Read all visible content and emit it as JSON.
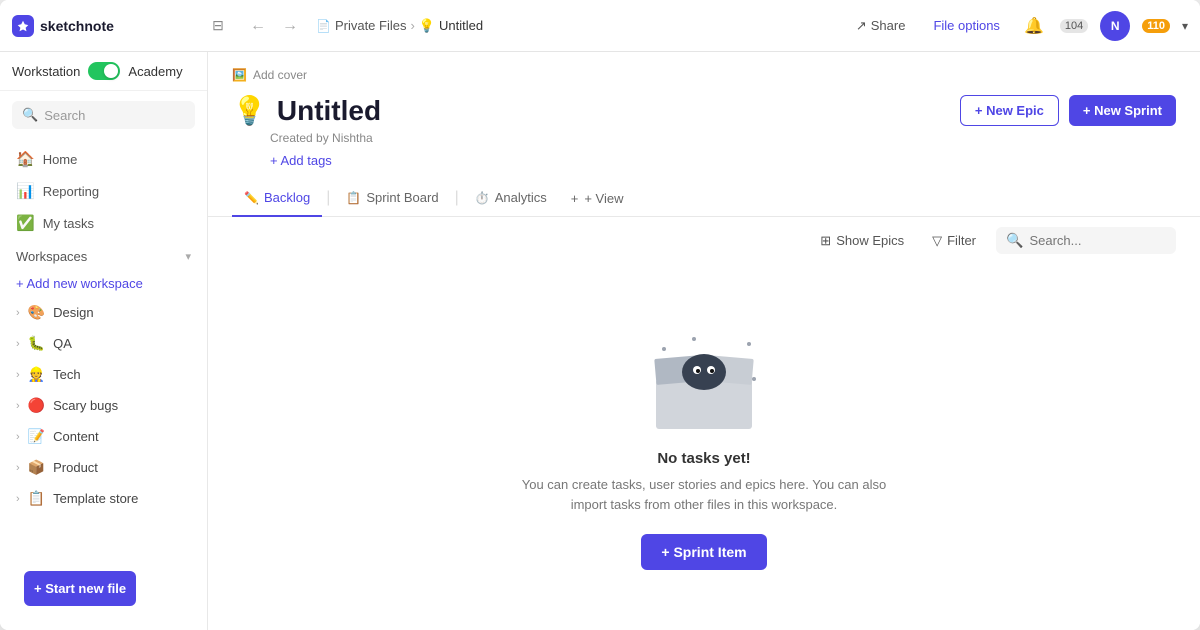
{
  "app": {
    "name": "sketchnote",
    "logo_emoji": "⚡"
  },
  "titlebar": {
    "workspace": "Workstation",
    "workspace_mode": "Academy",
    "breadcrumb": {
      "section": "Private Files",
      "current": "Untitled"
    },
    "share_label": "Share",
    "file_options_label": "File options",
    "notif_count": "104",
    "user_count": "110"
  },
  "sidebar": {
    "search_placeholder": "Search",
    "nav_items": [
      {
        "label": "Home",
        "icon": "🏠"
      },
      {
        "label": "Reporting",
        "icon": "📊"
      },
      {
        "label": "My tasks",
        "icon": "✅"
      }
    ],
    "workspaces_label": "Workspaces",
    "add_workspace_label": "+ Add new workspace",
    "workspace_items": [
      {
        "label": "Design",
        "emoji": "🎨"
      },
      {
        "label": "QA",
        "emoji": "🐛"
      },
      {
        "label": "Tech",
        "emoji": "👷"
      },
      {
        "label": "Scary bugs",
        "emoji": "🔴"
      },
      {
        "label": "Content",
        "emoji": "📝"
      },
      {
        "label": "Product",
        "emoji": "📦"
      },
      {
        "label": "Template store",
        "emoji": "📋"
      }
    ],
    "start_new_file_label": "+ Start new file"
  },
  "content": {
    "add_cover_label": "Add cover",
    "title_emoji": "💡",
    "title": "Untitled",
    "created_by": "Created by Nishtha",
    "add_tags_label": "+ Add tags",
    "new_epic_label": "+ New Epic",
    "new_sprint_label": "+ New Sprint"
  },
  "tabs": [
    {
      "label": "Backlog",
      "icon": "✏️",
      "active": true
    },
    {
      "label": "Sprint Board",
      "icon": "📋",
      "active": false
    },
    {
      "label": "Analytics",
      "icon": "⏱️",
      "active": false
    }
  ],
  "view_tab": "+ View",
  "toolbar": {
    "show_epics_label": "Show Epics",
    "filter_label": "Filter",
    "search_placeholder": "Search..."
  },
  "empty_state": {
    "title": "No tasks yet!",
    "description": "You can create tasks, user stories and epics here. You can also\nimport tasks from other files in this workspace.",
    "sprint_item_label": "+ Sprint Item"
  }
}
